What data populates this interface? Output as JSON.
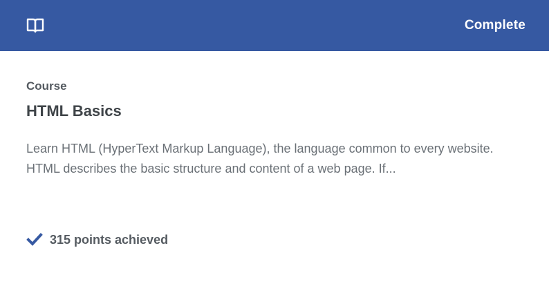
{
  "header": {
    "icon": "book-open-icon",
    "status_label": "Complete",
    "accent_color": "#3659a2"
  },
  "content": {
    "eyebrow": "Course",
    "title": "HTML Basics",
    "description": "Learn HTML (HyperText Markup Language), the language common to every website. HTML describes the basic structure and content of a web page. If..."
  },
  "footer": {
    "icon": "checkmark-icon",
    "points_text": "315 points achieved"
  }
}
